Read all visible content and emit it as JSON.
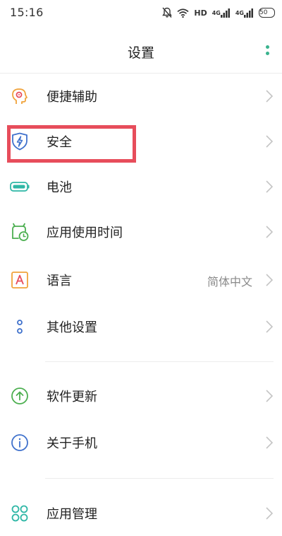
{
  "status_bar": {
    "time": "15:16",
    "network_label": "HD",
    "signal1_label": "4G",
    "signal2_label": "4G",
    "battery_level": "50"
  },
  "header": {
    "title": "设置"
  },
  "items": [
    {
      "label": "便捷辅助",
      "icon": "accessibility-icon",
      "color": "#f0a33b"
    },
    {
      "label": "安全",
      "icon": "security-shield-icon",
      "color": "#3f71cc"
    },
    {
      "label": "电池",
      "icon": "battery-icon",
      "color": "#2fb7a6"
    },
    {
      "label": "应用使用时间",
      "icon": "app-usage-time-icon",
      "color": "#4caf50"
    },
    {
      "label": "语言",
      "value": "简体中文",
      "icon": "language-icon",
      "color": "#f0a33b"
    },
    {
      "label": "其他设置",
      "icon": "other-settings-icon",
      "color": "#3f71cc"
    },
    {
      "label": "软件更新",
      "icon": "software-update-icon",
      "color": "#4caf50"
    },
    {
      "label": "关于手机",
      "icon": "about-phone-icon",
      "color": "#3f71cc"
    },
    {
      "label": "应用管理",
      "icon": "app-management-icon",
      "color": "#2fb7a6"
    }
  ],
  "highlight": {
    "target": "安全",
    "color": "#e74d5b"
  }
}
